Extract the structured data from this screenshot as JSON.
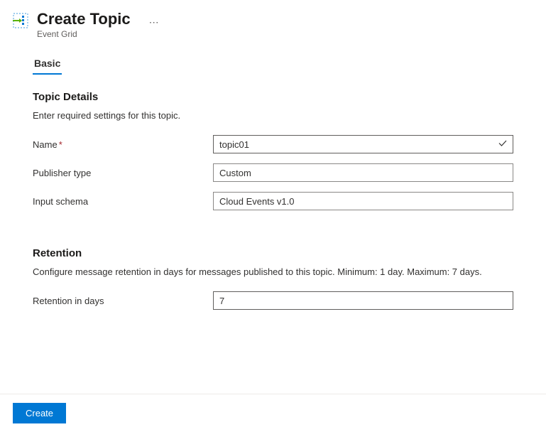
{
  "header": {
    "title": "Create Topic",
    "subtitle": "Event Grid"
  },
  "tabs": [
    {
      "label": "Basic",
      "active": true
    }
  ],
  "sections": {
    "topicDetails": {
      "heading": "Topic Details",
      "description": "Enter required settings for this topic.",
      "fields": {
        "name": {
          "label": "Name",
          "required": true,
          "value": "topic01",
          "valid": true
        },
        "publisherType": {
          "label": "Publisher type",
          "value": "Custom"
        },
        "inputSchema": {
          "label": "Input schema",
          "value": "Cloud Events v1.0"
        }
      }
    },
    "retention": {
      "heading": "Retention",
      "description": "Configure message retention in days for messages published to this topic. Minimum: 1 day. Maximum: 7 days.",
      "fields": {
        "retentionInDays": {
          "label": "Retention in days",
          "value": "7"
        }
      }
    }
  },
  "footer": {
    "createLabel": "Create"
  }
}
